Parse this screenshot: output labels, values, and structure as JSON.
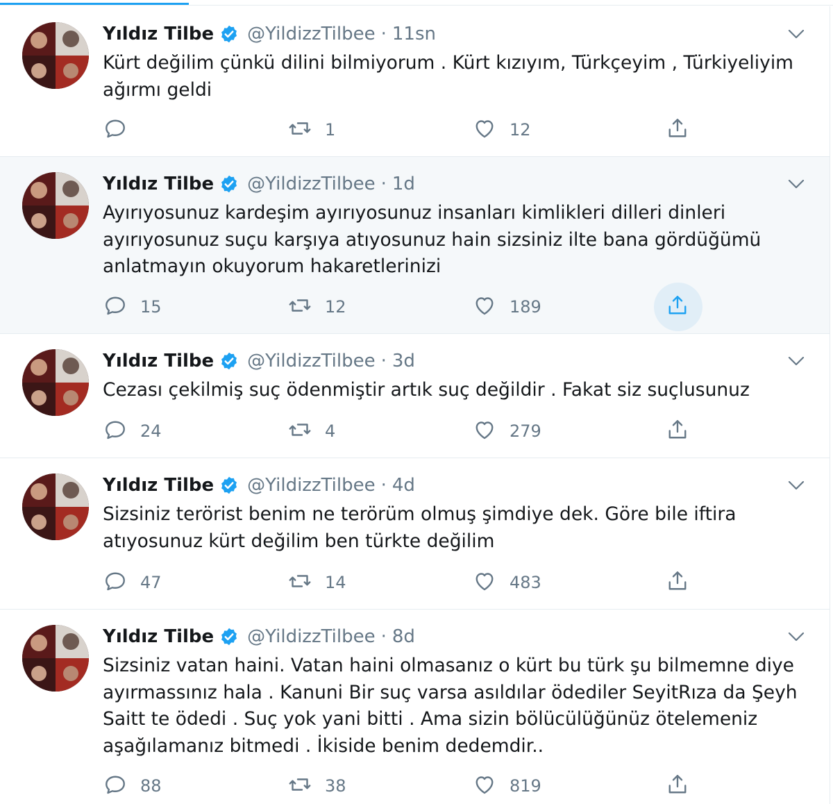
{
  "colors": {
    "accent": "#1da1f2",
    "text": "#14171a",
    "secondary": "#657786",
    "border": "#e6ecf0",
    "hover": "#f5f8fa"
  },
  "icons": {
    "reply": "reply-icon",
    "retweet": "retweet-icon",
    "like": "like-icon",
    "share": "share-icon",
    "verified": "verified-badge-icon",
    "caret": "chevron-down-icon"
  },
  "tweets": [
    {
      "name": "Yıldız Tilbe",
      "handle": "@YildizzTilbee",
      "separator": "·",
      "time": "11sn",
      "text": "Kürt değilim çünkü dilini bilmiyorum . Kürt kızıyım, Türkçeyim , Türkiyeliyim\nağırmı geldi",
      "replies": "",
      "retweets": "1",
      "likes": "12"
    },
    {
      "name": "Yıldız Tilbe",
      "handle": "@YildizzTilbee",
      "separator": "·",
      "time": "1d",
      "text": "Ayırıyosunuz kardeşim ayırıyosunuz insanları kimlikleri dilleri dinleri\nayırıyosunuz suçu karşıya atıyosunuz hain sizsiniz ilte bana gördüğümü\nanlatmayın okuyorum hakaretlerinizi",
      "replies": "15",
      "retweets": "12",
      "likes": "189"
    },
    {
      "name": "Yıldız Tilbe",
      "handle": "@YildizzTilbee",
      "separator": "·",
      "time": "3d",
      "text": "Cezası çekilmiş suç ödenmiştir artık suç değildir . Fakat siz suçlusunuz",
      "replies": "24",
      "retweets": "4",
      "likes": "279"
    },
    {
      "name": "Yıldız Tilbe",
      "handle": "@YildizzTilbee",
      "separator": "·",
      "time": "4d",
      "text": "Sizsiniz terörist benim ne terörüm olmuş şimdiye dek. Göre bile iftira\natıyosunuz kürt değilim ben türkte değilim",
      "replies": "47",
      "retweets": "14",
      "likes": "483"
    },
    {
      "name": "Yıldız Tilbe",
      "handle": "@YildizzTilbee",
      "separator": "·",
      "time": "8d",
      "text": "Sizsiniz vatan haini. Vatan haini olmasanız o kürt bu türk şu bilmemne diye\nayırmassınız hala . Kanuni Bir suç varsa asıldılar ödediler SeyitRıza da Şeyh\nSaitt te ödedi . Suç yok yani bitti . Ama sizin bölücülüğünüz ötelemeniz\naşağılamanız bitmedi . İkiside benim dedemdir..",
      "replies": "88",
      "retweets": "38",
      "likes": "819"
    }
  ]
}
